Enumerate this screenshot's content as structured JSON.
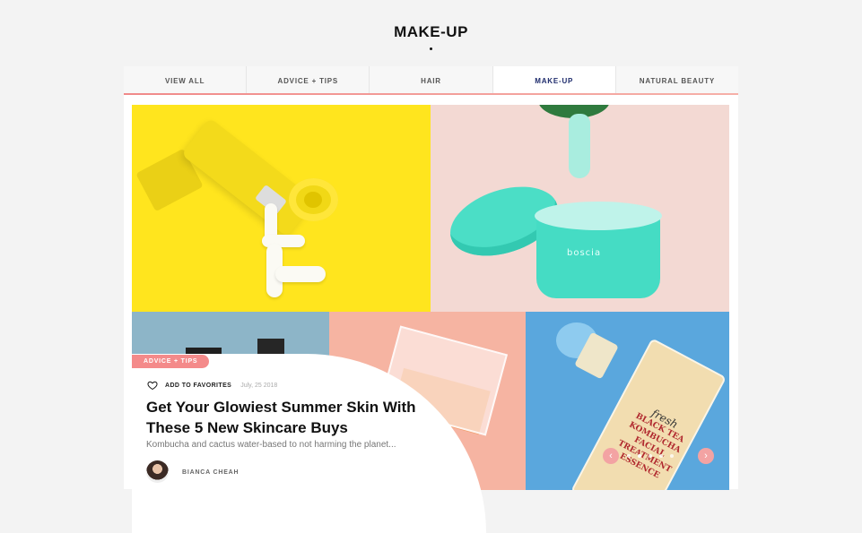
{
  "page": {
    "title": "MAKE-UP"
  },
  "tabs": [
    {
      "label": "VIEW ALL"
    },
    {
      "label": "ADVICE + TIPS"
    },
    {
      "label": "HAIR"
    },
    {
      "label": "MAKE-UP",
      "active": true
    },
    {
      "label": "NATURAL BEAUTY"
    }
  ],
  "featured": {
    "category": "ADVICE + TIPS",
    "favorite_label": "ADD TO FAVORITES",
    "date": "July, 25 2018",
    "headline": "Get Your Glowiest Summer Skin With These 5 New Skincare Buys",
    "excerpt": "Kombucha and cactus water-based to not harming the planet...",
    "author": "BIANCA CHEAH"
  },
  "images": {
    "jar_brand": "boscia",
    "serum_brand": "fresh",
    "serum_line1": "BLACK TEA",
    "serum_line2": "KOMBUCHA",
    "serum_line3": "FACIAL TREATMENT",
    "serum_line4": "ESSENCE"
  },
  "slider": {
    "prev_icon": "chevron-left-icon",
    "next_icon": "chevron-right-icon",
    "dot_count": 5,
    "active_dot": 1
  },
  "colors": {
    "accent": "#f48a8a",
    "active_tab": "#1d2a6b",
    "tile_yellow": "#ffe51e",
    "tile_pink": "#f3d9d3",
    "tile_blue": "#5aa7dd"
  }
}
